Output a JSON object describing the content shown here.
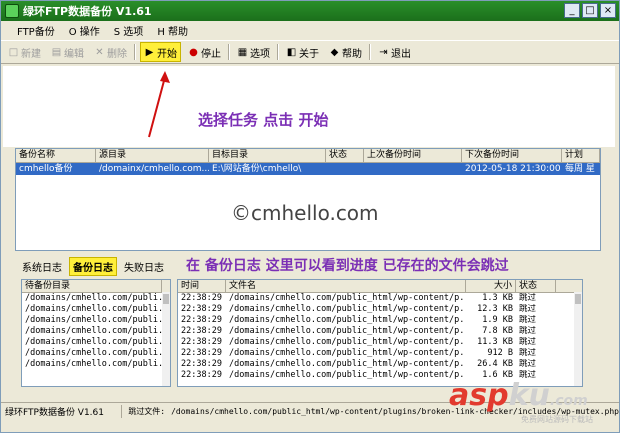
{
  "window": {
    "title": "绿环FTP数据备份 V1.61",
    "controls": [
      "_",
      "□",
      "×"
    ]
  },
  "menu": [
    "FTP备份",
    "O 操作",
    "S 选项",
    "H 帮助"
  ],
  "toolbar": {
    "new": "新建",
    "edit": "编辑",
    "delete": "删除",
    "start": "开始",
    "stop": "停止",
    "options": "选项",
    "about": "关于",
    "help": "帮助",
    "exit": "退出"
  },
  "instruction_top": "选择任务 点击 开始",
  "jobs": {
    "columns": [
      "备份名称",
      "源目录",
      "目标目录",
      "状态",
      "上次备份时间",
      "下次备份时间",
      "计划"
    ],
    "rows": [
      [
        "cmhello备份",
        "/domainx/cmhello.com...",
        "E:\\网站备份\\cmhello\\",
        "",
        "",
        "2012-05-18 21:30:00",
        "每周 星"
      ]
    ]
  },
  "watermark": "©cmhello.com",
  "log_tabs": [
    "系统日志",
    "备份日志",
    "失败日志"
  ],
  "active_tab": "备份日志",
  "instruction_bottom": "在 备份日志 这里可以看到进度 已存在的文件会跳过",
  "pending": {
    "header": "待备份目录",
    "rows": [
      "/domains/cmhello.com/publi...",
      "/domains/cmhello.com/publi...",
      "/domains/cmhello.com/publi...",
      "/domains/cmhello.com/publi...",
      "/domains/cmhello.com/publi...",
      "/domains/cmhello.com/publi...",
      "/domains/cmhello.com/publi..."
    ]
  },
  "log": {
    "columns": [
      "时间",
      "文件名",
      "大小",
      "状态"
    ],
    "rows": [
      [
        "22:38:29",
        "/domains/cmhello.com/public_html/wp-content/p...",
        "1.3 KB",
        "跳过"
      ],
      [
        "22:38:29",
        "/domains/cmhello.com/public_html/wp-content/p...",
        "12.3 KB",
        "跳过"
      ],
      [
        "22:38:29",
        "/domains/cmhello.com/public_html/wp-content/p...",
        "1.9 KB",
        "跳过"
      ],
      [
        "22:38:29",
        "/domains/cmhello.com/public_html/wp-content/p...",
        "7.8 KB",
        "跳过"
      ],
      [
        "22:38:29",
        "/domains/cmhello.com/public_html/wp-content/p...",
        "11.3 KB",
        "跳过"
      ],
      [
        "22:38:29",
        "/domains/cmhello.com/public_html/wp-content/p...",
        "912 B",
        "跳过"
      ],
      [
        "22:38:29",
        "/domains/cmhello.com/public_html/wp-content/p...",
        "26.4 KB",
        "跳过"
      ],
      [
        "22:38:29",
        "/domains/cmhello.com/public_html/wp-content/p...",
        "1.6 KB",
        "跳过"
      ]
    ]
  },
  "statusbar": {
    "app": "绿环FTP数据备份 V1.61",
    "skip_label": "跳过文件:",
    "skip_path": "/domains/cmhello.com/public_html/wp-content/plugins/broken-link-checker/includes/wp-mutex.php"
  },
  "logo": {
    "main": "asp",
    "accent": "ku",
    "suffix": ".com",
    "tagline": "免费网站源码下载站"
  },
  "colors": {
    "title_bar": "#1b6f1b",
    "highlight": "#ffef3a",
    "selection": "#316ac5",
    "instruction": "#7b2fb5",
    "arrow": "#d01010"
  }
}
